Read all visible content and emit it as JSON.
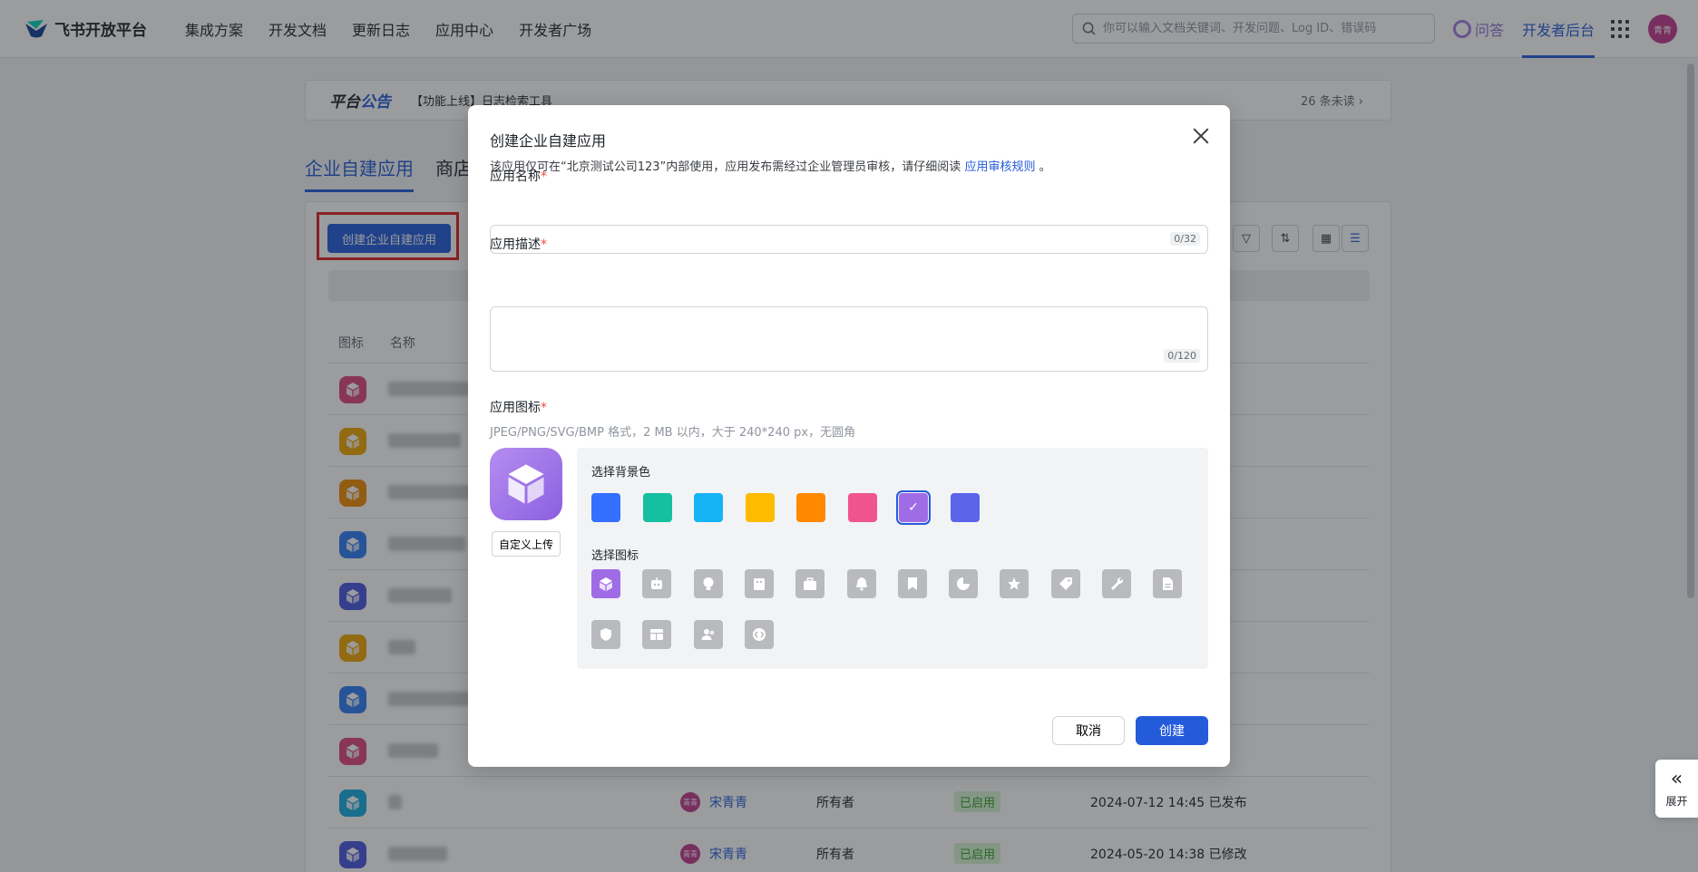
{
  "nav": {
    "brand": "飞书开放平台",
    "links": [
      "集成方案",
      "开发文档",
      "更新日志",
      "应用中心",
      "开发者广场"
    ],
    "search_placeholder": "你可以输入文档关键词、开发问题、Log ID、错误码",
    "qa": "问答",
    "dev_console": "开发者后台",
    "avatar": "青青"
  },
  "announcement": {
    "title_a": "平台",
    "title_b": "公告",
    "text": "【功能上线】日志检索工具",
    "unread": "26 条未读"
  },
  "tabs": [
    "企业自建应用",
    "商店"
  ],
  "toolbar": {
    "create_label": "创建企业自建应用"
  },
  "table": {
    "headers": {
      "icon": "图标",
      "name": "名称"
    },
    "rows": [
      {
        "color": "#e0457b"
      },
      {
        "color": "#f0a500"
      },
      {
        "color": "#f08a00"
      },
      {
        "color": "#2f7df6"
      },
      {
        "color": "#4a56e2"
      },
      {
        "color": "#f0a500"
      },
      {
        "color": "#2f7df6"
      },
      {
        "color": "#e0457b"
      },
      {
        "color": "#14a9e0",
        "owner": "宋青青",
        "role": "所有者",
        "status": "已启用",
        "time": "2024-07-12 14:45 已发布"
      },
      {
        "color": "#4a56e2",
        "owner": "宋青青",
        "role": "所有者",
        "status": "已启用",
        "time": "2024-05-20 14:38 已修改"
      }
    ]
  },
  "modal": {
    "title": "创建企业自建应用",
    "desc_prefix": "该应用仅可在“北京测试公司123”内部使用，应用发布需经过企业管理员审核，请仔细阅读",
    "desc_link": "应用审核规则",
    "desc_suffix": "。",
    "name_label": "应用名称",
    "name_counter": "0/32",
    "desc_label": "应用描述",
    "desc_counter": "0/120",
    "icon_label": "应用图标",
    "icon_hint": "JPEG/PNG/SVG/BMP 格式，2 MB 以内，大于 240*240 px，无圆角",
    "upload_label": "自定义上传",
    "bg_label": "选择背景色",
    "icon_pick_label": "选择图标",
    "bg_colors": [
      "#3370ff",
      "#14c0a0",
      "#14b4f5",
      "#ffbb00",
      "#ff8800",
      "#f0548f",
      "#9f6ce6",
      "#5b64ea"
    ],
    "icons": [
      "cube-icon",
      "robot-icon",
      "bulb-icon",
      "building-icon",
      "briefcase-icon",
      "bell-icon",
      "bookmark-icon",
      "pie-icon",
      "star-icon",
      "tag-icon",
      "wrench-icon",
      "doc-icon",
      "shield-icon",
      "layout-icon",
      "people-icon",
      "code-icon"
    ],
    "cancel": "取消",
    "confirm": "创建"
  },
  "expand": {
    "label": "展开"
  }
}
